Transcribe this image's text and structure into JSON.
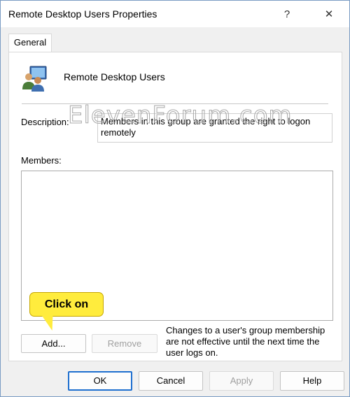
{
  "window": {
    "title": "Remote Desktop Users Properties",
    "help_glyph": "?",
    "close_glyph": "✕"
  },
  "tabs": [
    {
      "label": "General",
      "selected": true
    }
  ],
  "general": {
    "group_icon": "users-group-icon",
    "group_name": "Remote Desktop Users",
    "description_label": "Description:",
    "description_value": "Members in this group are granted the right to logon remotely",
    "members_label": "Members:",
    "members": [],
    "add_label": "Add...",
    "remove_label": "Remove",
    "membership_note": "Changes to a user's group membership are not effective until the next time the user logs on."
  },
  "annotation": {
    "callout_text": "Click on",
    "callout_color": "#ffec3d"
  },
  "watermark": {
    "text": "ElevenForum.com"
  },
  "footer": {
    "ok_label": "OK",
    "cancel_label": "Cancel",
    "apply_label": "Apply",
    "help_label": "Help"
  },
  "colors": {
    "accent": "#1e6fcf",
    "disabled_text": "#a0a0a0"
  }
}
